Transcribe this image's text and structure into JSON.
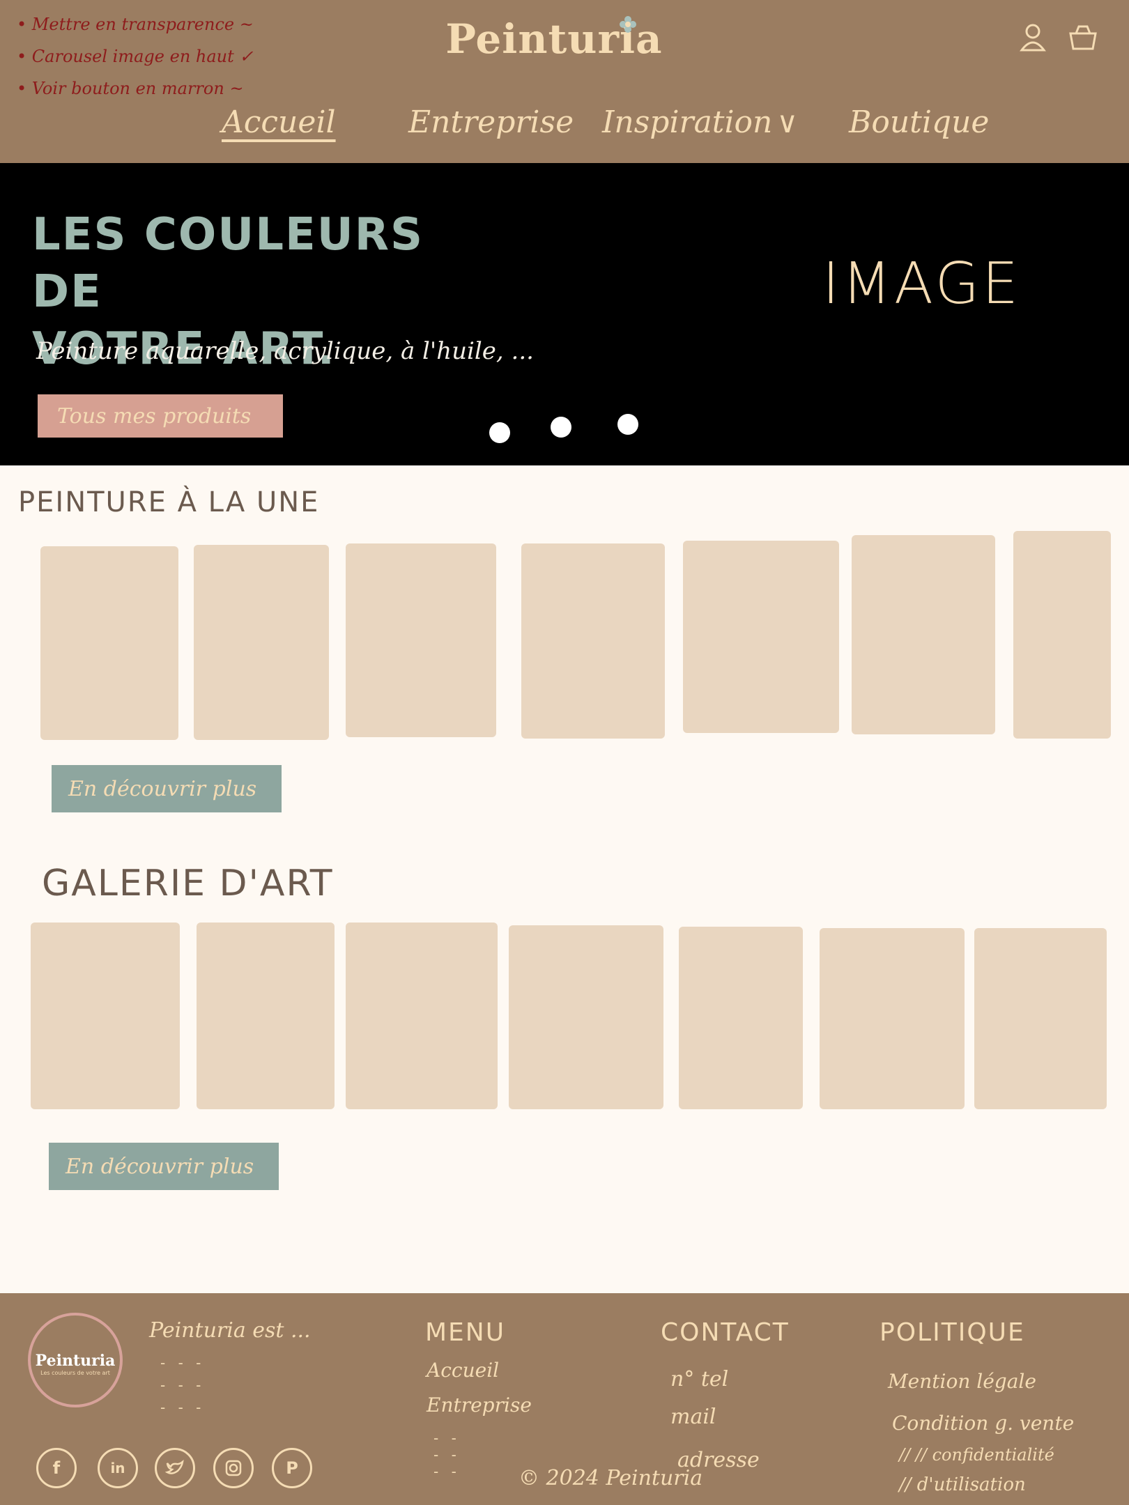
{
  "header": {
    "brand": "Peinturia",
    "notes": [
      "Mettre en transparence ~",
      "Carousel image en haut ✓",
      "Voir bouton en marron ~"
    ],
    "nav": [
      {
        "label": "Accueil",
        "active": true
      },
      {
        "label": "Entreprise",
        "active": false
      },
      {
        "label": "Inspiration",
        "active": false
      },
      {
        "label": "Boutique",
        "active": false
      }
    ]
  },
  "hero": {
    "title_line1": "LES COULEURS DE",
    "title_line2": "VOTRE ART.",
    "subtitle": "Peinture aquarelle, acrylique, à l'huile, ...",
    "cta_label": "Tous mes produits",
    "image_label": "IMAGE",
    "slides": 3
  },
  "featured": {
    "title": "PEINTURE À LA UNE",
    "card_count": 7,
    "more_label": "En découvrir plus"
  },
  "gallery": {
    "title": "GALERIE D'ART",
    "card_count": 7,
    "more_label": "En découvrir plus"
  },
  "footer": {
    "brand": "Peinturia",
    "tagline": "Les couleurs de votre art",
    "about": "Peinturia est ...",
    "menu_title": "MENU",
    "menu_items": [
      "Accueil",
      "Entreprise"
    ],
    "contact_title": "CONTACT",
    "contact_items": [
      "n° tel",
      "mail",
      "adresse"
    ],
    "policy_title": "POLITIQUE",
    "policy_items": [
      "Mention légale",
      "Condition g. vente",
      "//      //   confidentialité",
      "//   d'utilisation"
    ],
    "copyright": "© 2024 Peinturia",
    "social": [
      "facebook-icon",
      "linkedin-icon",
      "twitter-icon",
      "instagram-icon",
      "pinterest-icon"
    ]
  },
  "colors": {
    "header_bg": "#9b7d61",
    "accent_cream": "#f5dcb4",
    "hero_bg": "#000000",
    "hero_title": "#9eb8ae",
    "cta_pink": "#d6a092",
    "card": "#e9d6c0",
    "more_btn": "#8ea69f",
    "page_bg": "#fef9f3",
    "note_red": "#8e1c1c"
  }
}
